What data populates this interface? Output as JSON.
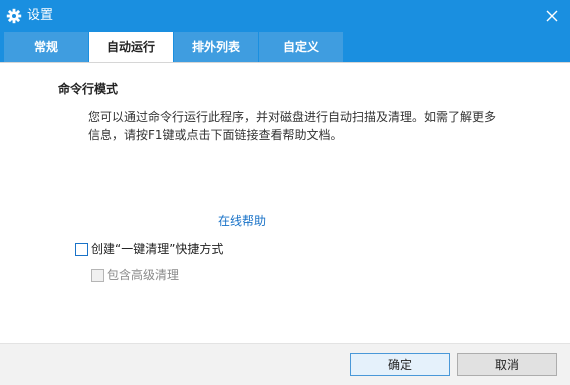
{
  "window": {
    "title": "设置",
    "icon": "gear-icon",
    "close_icon": "close-icon",
    "accent_color": "#1a8fe0"
  },
  "tabs": [
    {
      "label": "常规",
      "active": false
    },
    {
      "label": "自动运行",
      "active": true
    },
    {
      "label": "排外列表",
      "active": false
    },
    {
      "label": "自定义",
      "active": false
    }
  ],
  "content": {
    "section_title": "命令行模式",
    "description": "您可以通过命令行运行此程序，并对磁盘进行自动扫描及清理。如需了解更多信息，请按F1键或点击下面链接查看帮助文档。",
    "help_link": "在线帮助",
    "options": [
      {
        "label": "创建“一键清理”快捷方式",
        "checked": false,
        "enabled": true
      },
      {
        "label": "包含高级清理",
        "checked": false,
        "enabled": false
      }
    ]
  },
  "footer": {
    "ok_label": "确定",
    "cancel_label": "取消"
  }
}
